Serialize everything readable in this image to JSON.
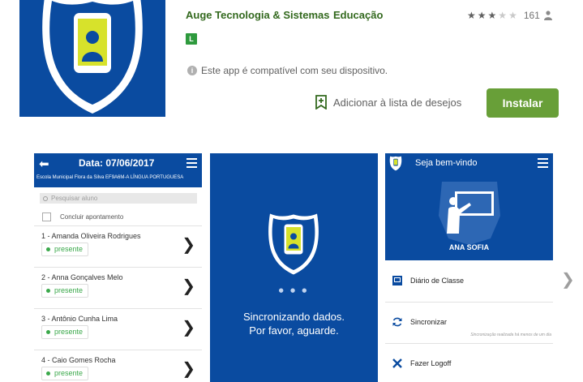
{
  "app": {
    "developer": "Auge Tecnologia & Sistemas",
    "category": "Educação",
    "rating_stars": 3,
    "rating_max": 5,
    "rating_count": "161",
    "content_rating": "L",
    "compatibility": "Este app é compatível com seu dispositivo.",
    "wishlist_label": "Adicionar à lista de desejos",
    "install_label": "Instalar",
    "brand_color": "#0a4ba0",
    "accent_color": "#689f38",
    "link_color": "#33691e"
  },
  "screenshot1": {
    "date_title": "Data: 07/06/2017",
    "subheader": "Escola Municipal Flora da Silva   EF9A6M-A   LÍNGUA PORTUGUESA",
    "search_placeholder": "Pesquisar aluno",
    "conclude_label": "Concluir apontamento",
    "students": [
      {
        "name": "1 - Amanda Oliveira Rodrigues",
        "status": "presente"
      },
      {
        "name": "2 - Anna Gonçalves Melo",
        "status": "presente"
      },
      {
        "name": "3 - Antônio Cunha Lima",
        "status": "presente"
      },
      {
        "name": "4 - Caio Gomes Rocha",
        "status": "presente"
      }
    ]
  },
  "screenshot2": {
    "sync_line1": "Sincronizando dados.",
    "sync_line2": "Por favor, aguarde.",
    "dots": "● ● ●"
  },
  "screenshot3": {
    "welcome": "Seja bem-vindo",
    "user_name": "ANA SOFIA",
    "menu": [
      {
        "label": "Diário de Classe",
        "icon": "book-icon"
      },
      {
        "label": "Sincronizar",
        "icon": "sync-icon",
        "note": "Sincronização realizada há menos de um dia"
      },
      {
        "label": "Fazer Logoff",
        "icon": "close-icon"
      }
    ]
  }
}
